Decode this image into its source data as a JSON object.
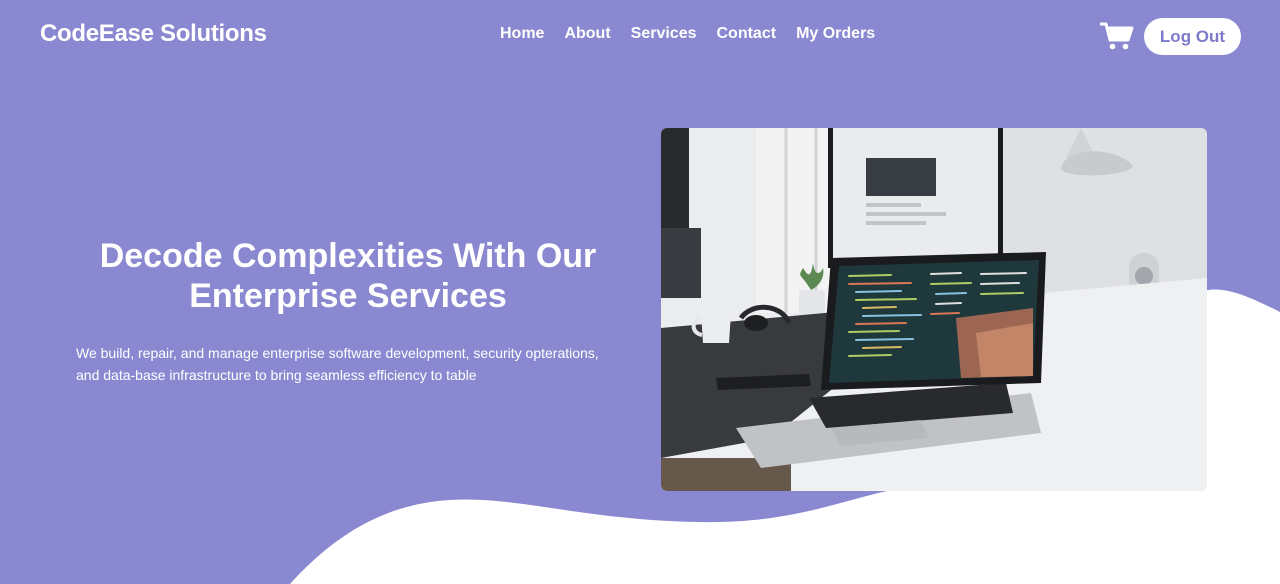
{
  "brand": "CodeEase Solutions",
  "nav": {
    "items": [
      "Home",
      "About",
      "Services",
      "Contact",
      "My Orders"
    ],
    "cart_icon": "shopping-cart-icon",
    "logout_label": "Log Out"
  },
  "hero": {
    "title_line1": "Decode Complexities With Our",
    "title_line2": "Enterprise Services",
    "description_line1": "We build, repair, and manage enterprise software development, security opterations,",
    "description_line2": "and data-base infrastructure to bring seamless efficiency to table",
    "image_subject": "laptop-on-desk-with-code-photo"
  },
  "colors": {
    "background": "#8a88d0",
    "wave": "#ffffff",
    "button_text": "#7d7bc9",
    "text": "#ffffff"
  }
}
